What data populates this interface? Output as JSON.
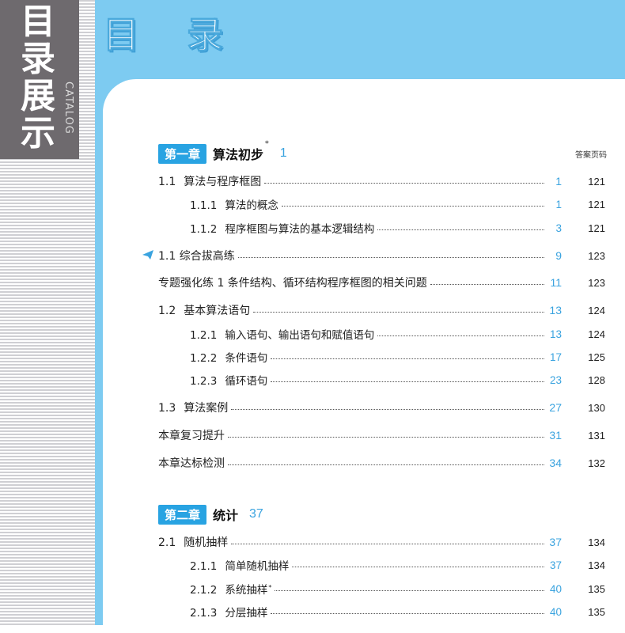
{
  "sidebar": {
    "title_chars": [
      "目",
      "录",
      "展",
      "示"
    ],
    "catalog": "CATALOG"
  },
  "header": {
    "title": "目  录"
  },
  "answer_page_header": "答案页码",
  "chapters": [
    {
      "badge": "第一章",
      "name": "算法初步",
      "star": "*",
      "page": "1",
      "entries": [
        {
          "num": "1.1",
          "label": "算法与程序框图",
          "page": "1",
          "answer": "121"
        },
        {
          "num": "1.1.1",
          "label": "算法的概念",
          "page": "1",
          "answer": "121"
        },
        {
          "num": "1.1.2",
          "label": "程序框图与算法的基本逻辑结构",
          "page": "3",
          "answer": "121"
        },
        {
          "num": "",
          "label": "1.1 综合拔高练",
          "page": "9",
          "answer": "123"
        },
        {
          "num": "",
          "label": "专题强化练 1   条件结构、循环结构程序框图的相关问题",
          "page": "11",
          "answer": "123"
        },
        {
          "num": "1.2",
          "label": "基本算法语句",
          "page": "13",
          "answer": "124"
        },
        {
          "num": "1.2.1",
          "label": "输入语句、输出语句和赋值语句",
          "page": "13",
          "answer": "124"
        },
        {
          "num": "1.2.2",
          "label": "条件语句",
          "page": "17",
          "answer": "125"
        },
        {
          "num": "1.2.3",
          "label": "循环语句",
          "page": "23",
          "answer": "128"
        },
        {
          "num": "1.3",
          "label": "算法案例",
          "page": "27",
          "answer": "130"
        },
        {
          "num": "",
          "label": "本章复习提升",
          "page": "31",
          "answer": "131"
        },
        {
          "num": "",
          "label": "本章达标检测",
          "page": "34",
          "answer": "132"
        }
      ]
    },
    {
      "badge": "第二章",
      "name": "统计",
      "page": "37",
      "entries": [
        {
          "num": "2.1",
          "label": "随机抽样",
          "page": "37",
          "answer": "134"
        },
        {
          "num": "2.1.1",
          "label": "简单随机抽样",
          "page": "37",
          "answer": "134"
        },
        {
          "num": "2.1.2",
          "label": "系统抽样",
          "star": "*",
          "page": "40",
          "answer": "135"
        },
        {
          "num": "2.1.3",
          "label": "分层抽样",
          "page": "40",
          "answer": "135"
        }
      ]
    }
  ],
  "colors": {
    "sky": "#7dcbf1",
    "accent": "#28a3e2",
    "gray_block": "#6e6a6e"
  },
  "icons": {
    "exercise_marker": "paper-plane-icon"
  }
}
